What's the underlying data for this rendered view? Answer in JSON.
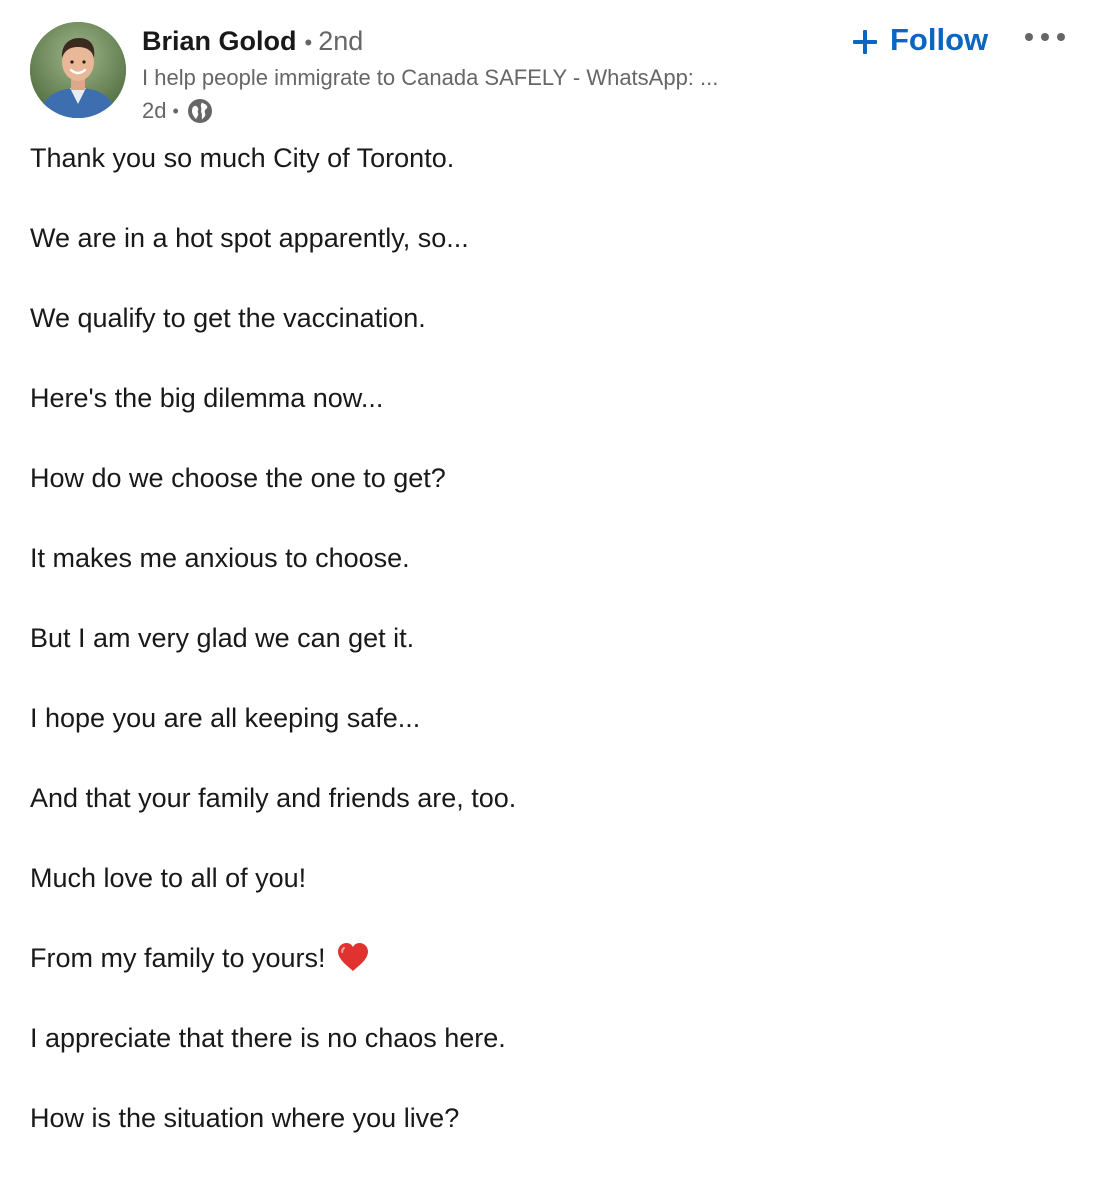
{
  "post": {
    "actor": {
      "name": "Brian Golod",
      "separator": "•",
      "degree": "2nd",
      "headline": "I help people immigrate to Canada SAFELY - WhatsApp: ...",
      "time": "2d",
      "meta_separator": "•",
      "visibility_icon": "globe-icon",
      "avatar_icon": "profile-photo"
    },
    "follow": {
      "icon": "plus-icon",
      "label": "Follow",
      "color": "#0a66c2"
    },
    "more": {
      "icon": "more-horizontal-icon",
      "label": "•••"
    },
    "lines": [
      "Thank you so much City of Toronto.",
      "We are in a hot spot apparently, so...",
      "We qualify to get the vaccination.",
      "Here's the big dilemma now...",
      "How do we choose the one to get?",
      "It makes me anxious to choose.",
      "But I am very glad we can get it.",
      "I hope you are all keeping safe...",
      "And that your family and friends are, too.",
      "Much love to all of you!",
      "From my family to yours!",
      "I appreciate that there is no chaos here.",
      "How is the situation where you live?"
    ],
    "emoji": {
      "line_index": 10,
      "icon": "red-heart-icon",
      "color": "#e0332f"
    }
  }
}
